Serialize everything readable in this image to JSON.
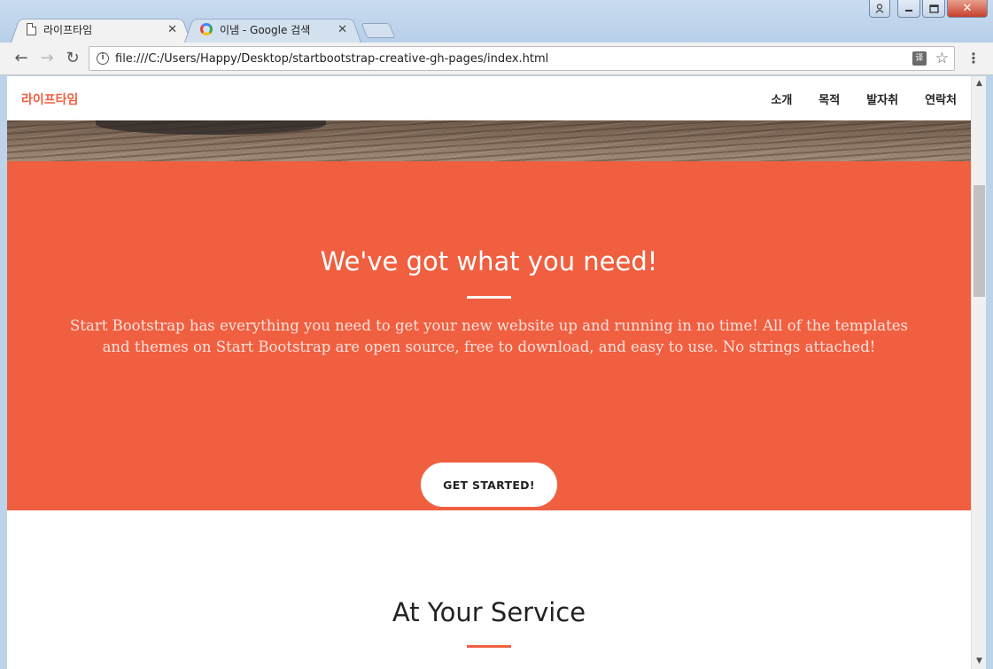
{
  "window": {
    "controls": {
      "close": "✕",
      "minimize": "–",
      "maximize": "◻",
      "user": "👤"
    }
  },
  "tabs": [
    {
      "title": "라이프타임",
      "icon": "page-icon",
      "active": true,
      "close": "✕"
    },
    {
      "title": "이냄 - Google 검색",
      "icon": "google-icon",
      "active": false,
      "close": "✕"
    }
  ],
  "toolbar": {
    "back": "←",
    "forward": "→",
    "reload": "↻",
    "url": "file:///C:/Users/Happy/Desktop/startbootstrap-creative-gh-pages/index.html",
    "info": "i",
    "translate": "译",
    "star": "☆",
    "menu": "⋮"
  },
  "site": {
    "brand": "라이프타임",
    "nav": [
      "소개",
      "목적",
      "발자취",
      "연락처"
    ],
    "hero": {
      "heading": "We've got what you need!",
      "text": "Start Bootstrap has everything you need to get your new website up and running in no time! All of the templates and themes on Start Bootstrap are open source, free to download, and easy to use. No strings attached!",
      "button": "GET STARTED!"
    },
    "services": {
      "heading": "At Your Service"
    }
  },
  "scrollbar": {
    "up": "▲",
    "down": "▼"
  },
  "colors": {
    "primary": "#f05f40",
    "hero_bg": "#f05f40",
    "text_dark": "#222222"
  }
}
